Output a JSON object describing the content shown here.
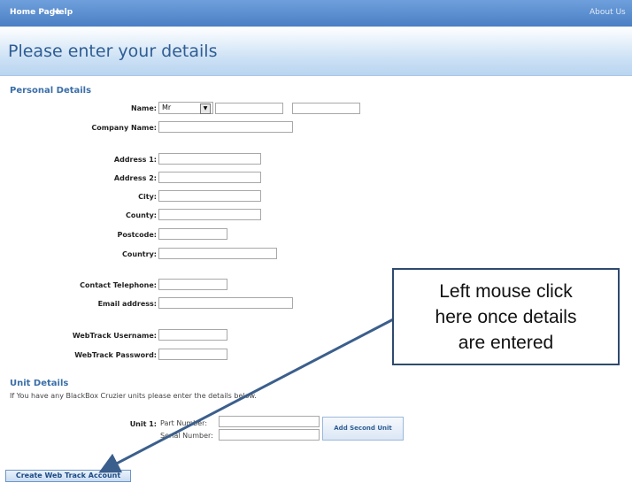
{
  "nav": {
    "home": "Home Page",
    "help": "Help",
    "about": "About Us"
  },
  "page_title": "Please enter your details",
  "personal": {
    "heading": "Personal Details",
    "name_label": "Name:",
    "title_value": "Mr",
    "company_label": "Company Name:",
    "address1_label": "Address 1:",
    "address2_label": "Address 2:",
    "city_label": "City:",
    "county_label": "County:",
    "postcode_label": "Postcode:",
    "country_label": "Country:",
    "phone_label": "Contact Telephone:",
    "email_label": "Email address:",
    "username_label": "WebTrack Username:",
    "password_label": "WebTrack Password:"
  },
  "unit": {
    "heading": "Unit Details",
    "note": "If You have any BlackBox Cruzier units please enter the details below.",
    "unit_label": "Unit 1:",
    "part_label": "Part Number:",
    "serial_label": "Serial Number:",
    "add_button": "Add Second Unit"
  },
  "create_button": "Create Web Track Account",
  "callout": {
    "line1": "Left mouse click",
    "line2": "here once details",
    "line3": "are entered"
  }
}
